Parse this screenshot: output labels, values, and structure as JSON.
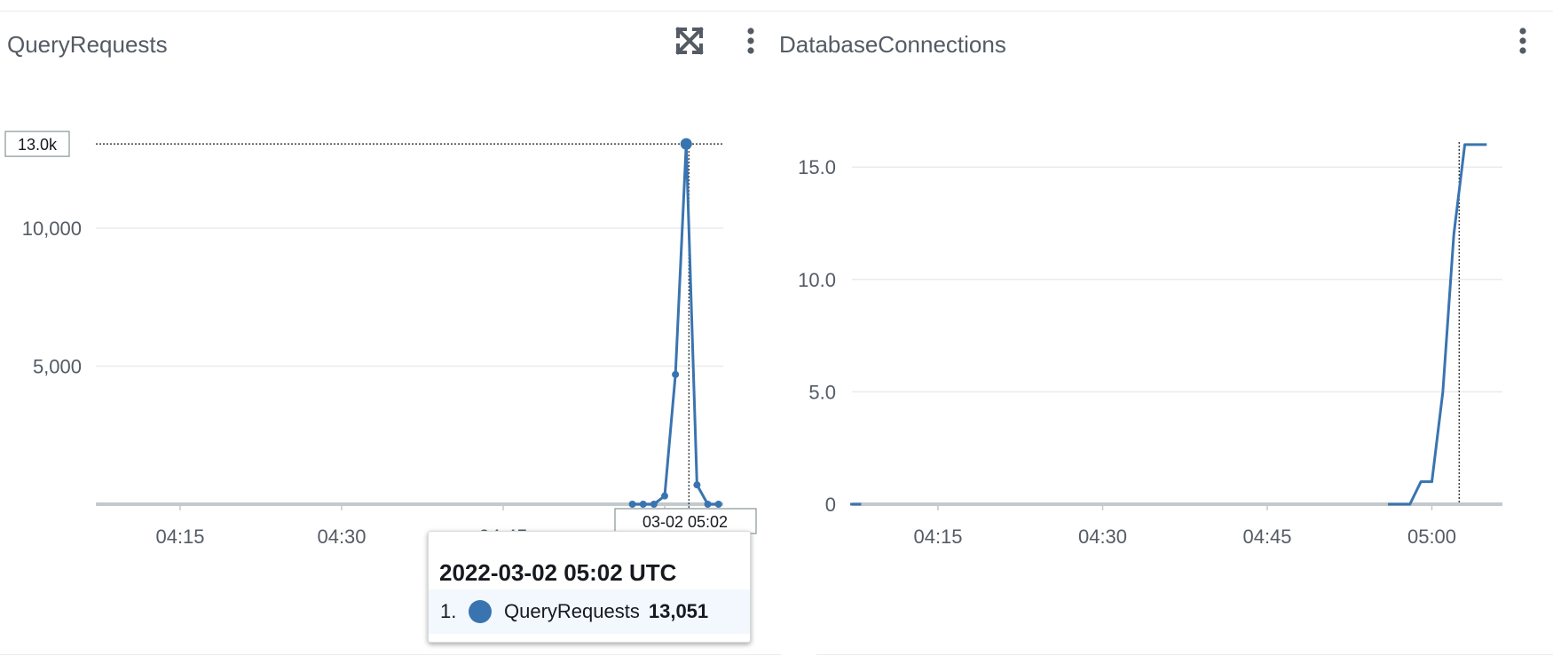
{
  "colors": {
    "series": "#3a74b0",
    "grid": "#e9ebed",
    "axis": "#c4c9cc",
    "text": "#545b64"
  },
  "widgets": [
    {
      "title": "QueryRequests",
      "icons": [
        "maximize-icon",
        "more-vertical-icon"
      ],
      "chart_data": {
        "type": "line",
        "title": "QueryRequests",
        "xlabel": "",
        "ylabel": "",
        "x_ticks": [
          "04:15",
          "04:30",
          "04:45",
          "05:00"
        ],
        "y_ticks": [
          "5,000",
          "10,000"
        ],
        "ylim": [
          0,
          13500
        ],
        "grid": true,
        "series": [
          {
            "name": "QueryRequests",
            "x": [
              "04:57",
              "04:58",
              "04:59",
              "05:00",
              "05:01",
              "05:02",
              "05:03",
              "05:04",
              "05:05"
            ],
            "values": [
              0,
              0,
              0,
              300,
              4700,
              13051,
              700,
              0,
              0
            ]
          }
        ],
        "highlight": {
          "x": "05:02",
          "y_label": "13.0k",
          "x_label": "03-02 05:02"
        }
      },
      "tooltip": {
        "title": "2022-03-02 05:02 UTC",
        "index": "1.",
        "series": "QueryRequests",
        "value": "13,051"
      }
    },
    {
      "title": "DatabaseConnections",
      "icons": [
        "more-vertical-icon"
      ],
      "chart_data": {
        "type": "line",
        "title": "DatabaseConnections",
        "xlabel": "",
        "ylabel": "",
        "x_ticks": [
          "04:15",
          "04:30",
          "04:45",
          "05:00"
        ],
        "y_ticks": [
          "0",
          "5.0",
          "10.0",
          "15.0"
        ],
        "ylim": [
          0,
          16
        ],
        "grid": true,
        "series": [
          {
            "x": [
              "04:07",
              "04:08",
              "04:56",
              "04:58",
              "04:59",
              "05:00",
              "05:01",
              "05:02",
              "05:03",
              "05:04",
              "05:05"
            ],
            "values": [
              0,
              0,
              0,
              0,
              1,
              1,
              5,
              12,
              16,
              16,
              16
            ]
          }
        ],
        "cursor": {
          "x": "05:02"
        }
      }
    }
  ]
}
